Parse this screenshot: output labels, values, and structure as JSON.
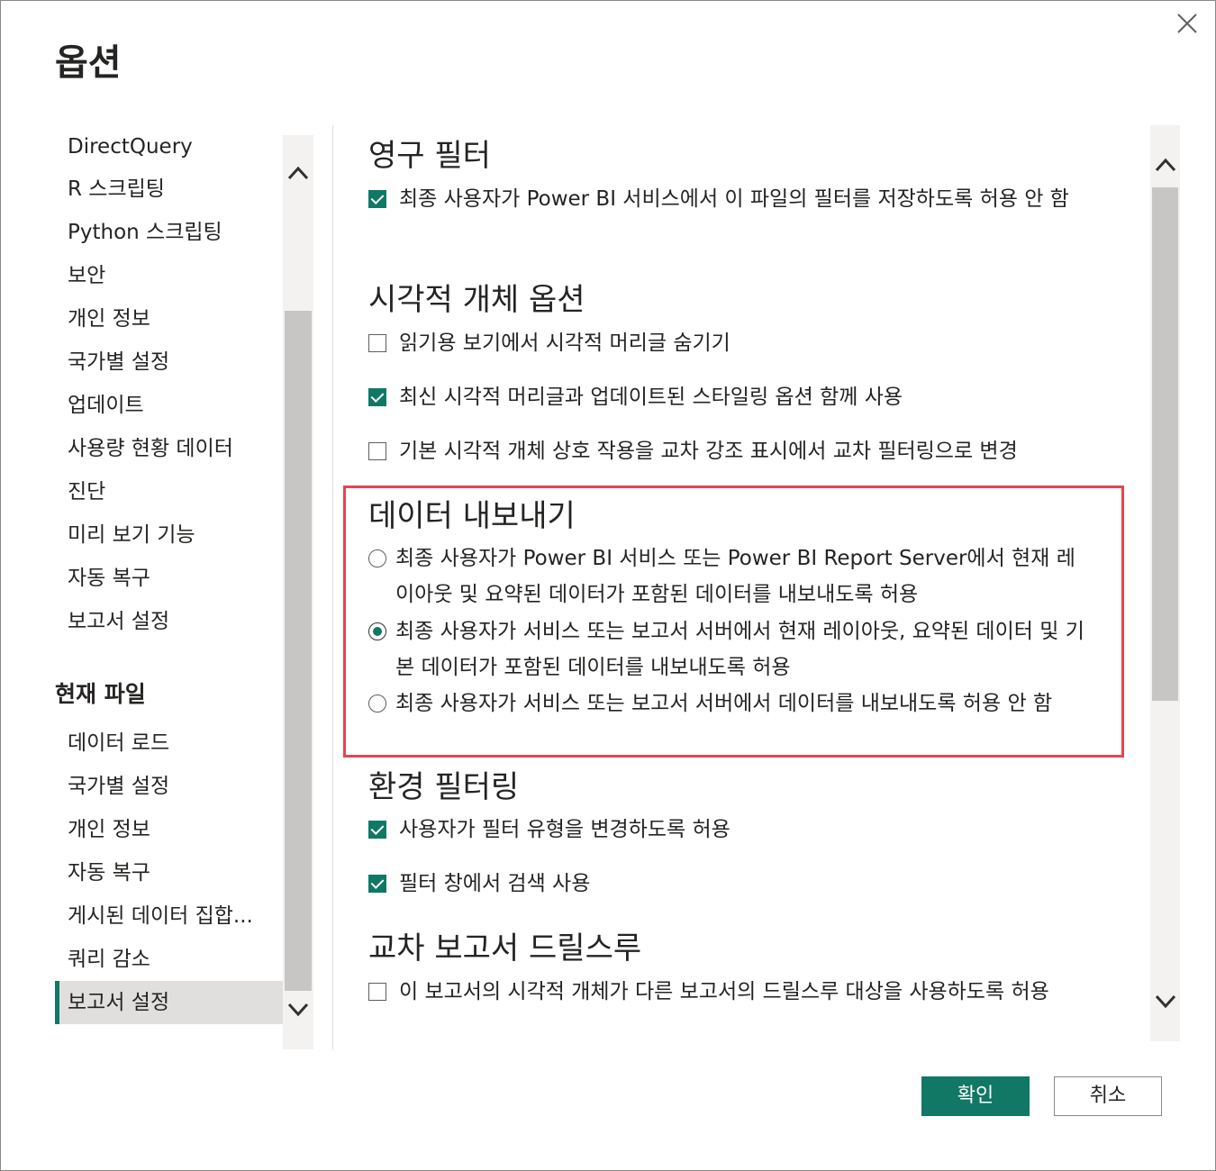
{
  "dialog": {
    "title": "옵션",
    "close_icon": "close-icon"
  },
  "nav": {
    "items": [
      "DirectQuery",
      "R 스크립팅",
      "Python 스크립팅",
      "보안",
      "개인 정보",
      "국가별 설정",
      "업데이트",
      "사용량 현황 데이터",
      "진단",
      "미리 보기 기능",
      "자동 복구",
      "보고서 설정"
    ],
    "section_title": "현재 파일",
    "file_items": [
      "데이터 로드",
      "국가별 설정",
      "개인 정보",
      "자동 복구",
      "게시된 데이터 집합...",
      "쿼리 감소",
      "보고서 설정"
    ],
    "selected": "보고서 설정"
  },
  "content": {
    "persistent_filters": {
      "title": "영구 필터",
      "option1": {
        "label": "최종 사용자가 Power BI 서비스에서 이 파일의 필터를 저장하도록 허용 안 함",
        "checked": true
      }
    },
    "visual_options": {
      "title": "시각적 개체 옵션",
      "option1": {
        "label": "읽기용 보기에서 시각적 머리글 숨기기",
        "checked": false
      },
      "option2": {
        "label": "최신 시각적 머리글과 업데이트된 스타일링 옵션 함께 사용",
        "checked": true
      },
      "option3": {
        "label": "기본 시각적 개체 상호 작용을 교차 강조 표시에서 교차 필터링으로 변경",
        "checked": false
      }
    },
    "export_data": {
      "title": "데이터 내보내기",
      "option1": {
        "label": "최종 사용자가 Power BI 서비스 또는 Power BI Report Server에서 현재 레이아웃 및 요약된 데이터가 포함된 데이터를 내보내도록 허용",
        "selected": false
      },
      "option2": {
        "label": "최종 사용자가 서비스 또는 보고서 서버에서 현재 레이아웃, 요약된 데이터 및 기본 데이터가 포함된 데이터를 내보내도록 허용",
        "selected": true
      },
      "option3": {
        "label": "최종 사용자가 서비스 또는 보고서 서버에서 데이터를 내보내도록 허용 안 함",
        "selected": false
      }
    },
    "filtering_experience": {
      "title": "환경 필터링",
      "option1": {
        "label": "사용자가 필터 유형을 변경하도록 허용",
        "checked": true
      },
      "option2": {
        "label": "필터 창에서 검색 사용",
        "checked": true
      }
    },
    "cross_report": {
      "title": "교차 보고서 드릴스루",
      "option1": {
        "label": "이 보고서의 시각적 개체가 다른 보고서의 드릴스루 대상을 사용하도록 허용",
        "checked": false
      }
    }
  },
  "buttons": {
    "ok": "확인",
    "cancel": "취소"
  },
  "colors": {
    "accent": "#117865",
    "highlight_border": "#e8434f",
    "nav_selected_bg": "#e1dfdd"
  }
}
